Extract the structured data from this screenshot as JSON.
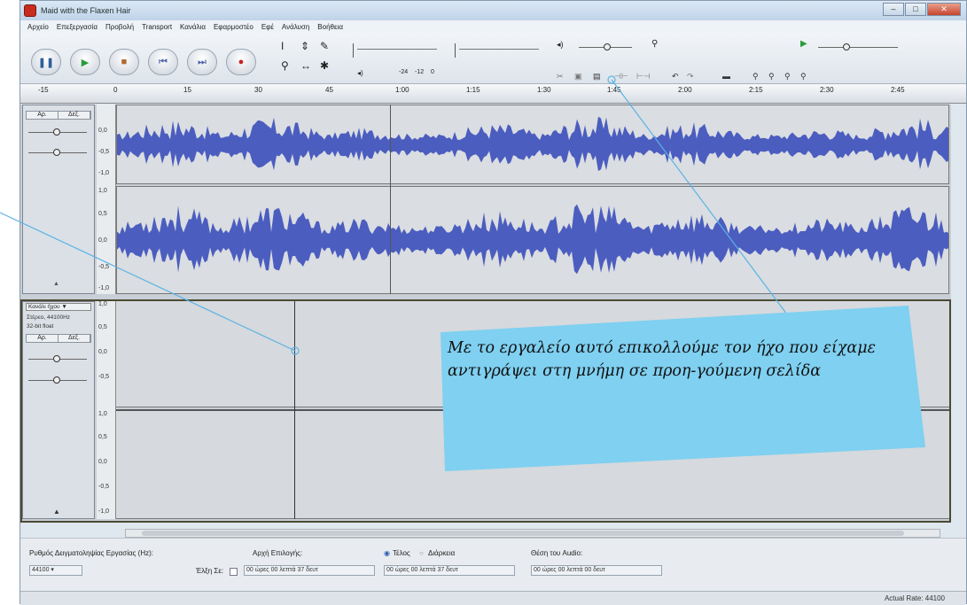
{
  "window": {
    "title": "Maid with the Flaxen Hair"
  },
  "menu": [
    "Αρχείο",
    "Επεξεργασία",
    "Προβολή",
    "Transport",
    "Κανάλια",
    "Εφαρμοστέο",
    "Εφέ",
    "Ανάλυση",
    "Βοήθεια"
  ],
  "transport": {
    "pause": "❚❚",
    "play": "▶",
    "stop": "■",
    "skip_start": "⏮",
    "skip_end": "⏭",
    "record": "●"
  },
  "tools": {
    "select": "I",
    "envelope": "⇕",
    "draw": "✎",
    "zoom": "⚲",
    "timeshift": "↔",
    "multi": "✱"
  },
  "meters": {
    "out_label": "◂)",
    "mark1": "-24",
    "mark2": "-12",
    "mark3": "0"
  },
  "ruler": [
    "-15",
    "0",
    "15",
    "30",
    "45",
    "1:00",
    "1:15",
    "1:30",
    "1:45",
    "2:00",
    "2:15",
    "2:30",
    "2:45"
  ],
  "track1": {
    "lr_left": "Αρ.",
    "lr_right": "Δεξ.",
    "scale": [
      "1,0",
      "0,5",
      "0,0",
      "-0,5",
      "-1,0"
    ]
  },
  "track2": {
    "name": "Κανάλι ήχου",
    "rate": "Στέρεο, 44100Hz",
    "format": "32-bit float",
    "lr_left": "Αρ.",
    "lr_right": "Δεξ.",
    "scale": [
      "1,0",
      "0,5",
      "0,0",
      "-0,5",
      "-1,0"
    ]
  },
  "bottom": {
    "project_rate_label": "Ρυθμός Δειγματοληψίας Εργασίας (Hz):",
    "project_rate": "44100",
    "snap_label": "Έλξη Σε:",
    "sel_start_label": "Αρχή Επιλογής:",
    "end_label": "Τέλος",
    "length_label": "Διάρκεια",
    "audio_pos_label": "Θέση του Audio:",
    "sel_start": "00 ώρες 00 λεπτά 37 δευτ",
    "sel_end": "00 ώρες 00 λεπτά 37 δευτ",
    "audio_pos": "00 ώρες 00 λεπτά 00 δευτ"
  },
  "status": "Actual Rate: 44100",
  "callout": {
    "text": "Με το εργαλείο αυτό επικολλούμε τον ήχο που είχαμε αντιγράψει στη μνήμη σε προη-γούμενη σελίδα"
  },
  "colors": {
    "callout": "#7fd0f1",
    "wave": "#4b5dbf",
    "line": "#5ab3e6"
  }
}
